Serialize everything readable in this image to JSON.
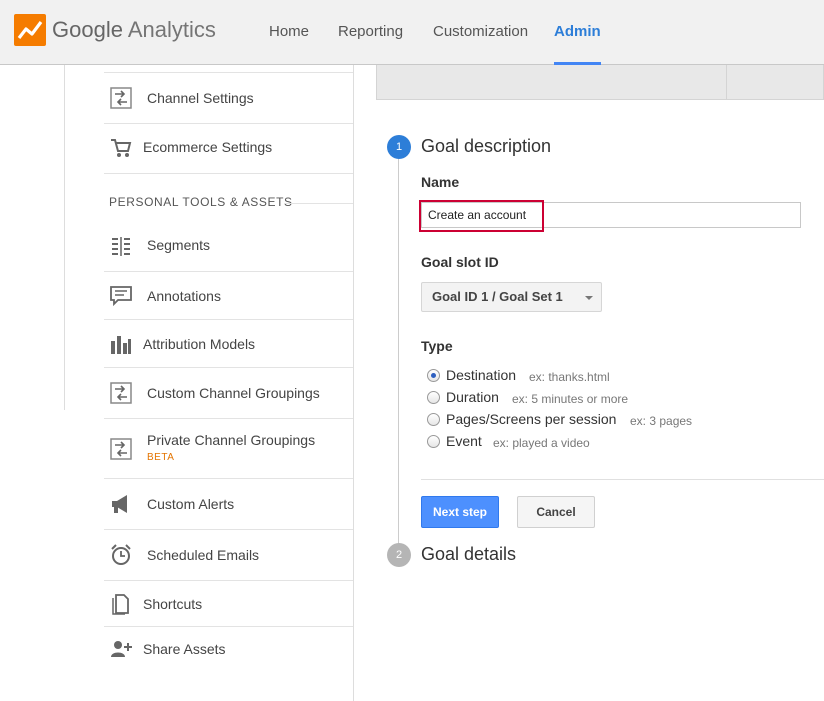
{
  "header": {
    "brand_google": "Google",
    "brand_analytics": "Analytics",
    "nav": [
      {
        "label": "Home"
      },
      {
        "label": "Reporting"
      },
      {
        "label": "Customization"
      },
      {
        "label": "Admin",
        "active": true
      }
    ]
  },
  "sidebar": {
    "section_heading": "PERSONAL TOOLS & ASSETS",
    "items": [
      {
        "label": "Channel Settings",
        "icon": "channel-settings-icon"
      },
      {
        "label": "Ecommerce Settings",
        "icon": "cart-icon"
      },
      {
        "label": "Segments",
        "icon": "segments-icon"
      },
      {
        "label": "Annotations",
        "icon": "annotations-icon"
      },
      {
        "label": "Attribution Models",
        "icon": "bar-chart-icon"
      },
      {
        "label": "Custom Channel Groupings",
        "icon": "channel-groupings-icon"
      },
      {
        "label": "Private Channel Groupings",
        "icon": "channel-groupings-icon",
        "badge": "BETA"
      },
      {
        "label": "Custom Alerts",
        "icon": "megaphone-icon"
      },
      {
        "label": "Scheduled Emails",
        "icon": "alarm-clock-icon"
      },
      {
        "label": "Shortcuts",
        "icon": "document-icon"
      },
      {
        "label": "Share Assets",
        "icon": "add-user-icon"
      }
    ]
  },
  "goal": {
    "step1_number": "1",
    "step1_title": "Goal description",
    "name_label": "Name",
    "name_value": "Create an account",
    "slot_label": "Goal slot ID",
    "slot_value": "Goal ID 1 / Goal Set 1",
    "type_label": "Type",
    "types": [
      {
        "label": "Destination",
        "example": "ex: thanks.html",
        "checked": true
      },
      {
        "label": "Duration",
        "example": "ex: 5 minutes or more",
        "checked": false
      },
      {
        "label": "Pages/Screens per session",
        "example": "ex: 3 pages",
        "checked": false
      },
      {
        "label": "Event",
        "example": "ex: played a video",
        "checked": false
      }
    ],
    "next_button": "Next step",
    "cancel_button": "Cancel",
    "step2_number": "2",
    "step2_title": "Goal details"
  },
  "colors": {
    "accent": "#2d7ed8",
    "primary_button": "#4d90fe",
    "highlight_border": "#cc0033",
    "beta": "#e37400"
  }
}
